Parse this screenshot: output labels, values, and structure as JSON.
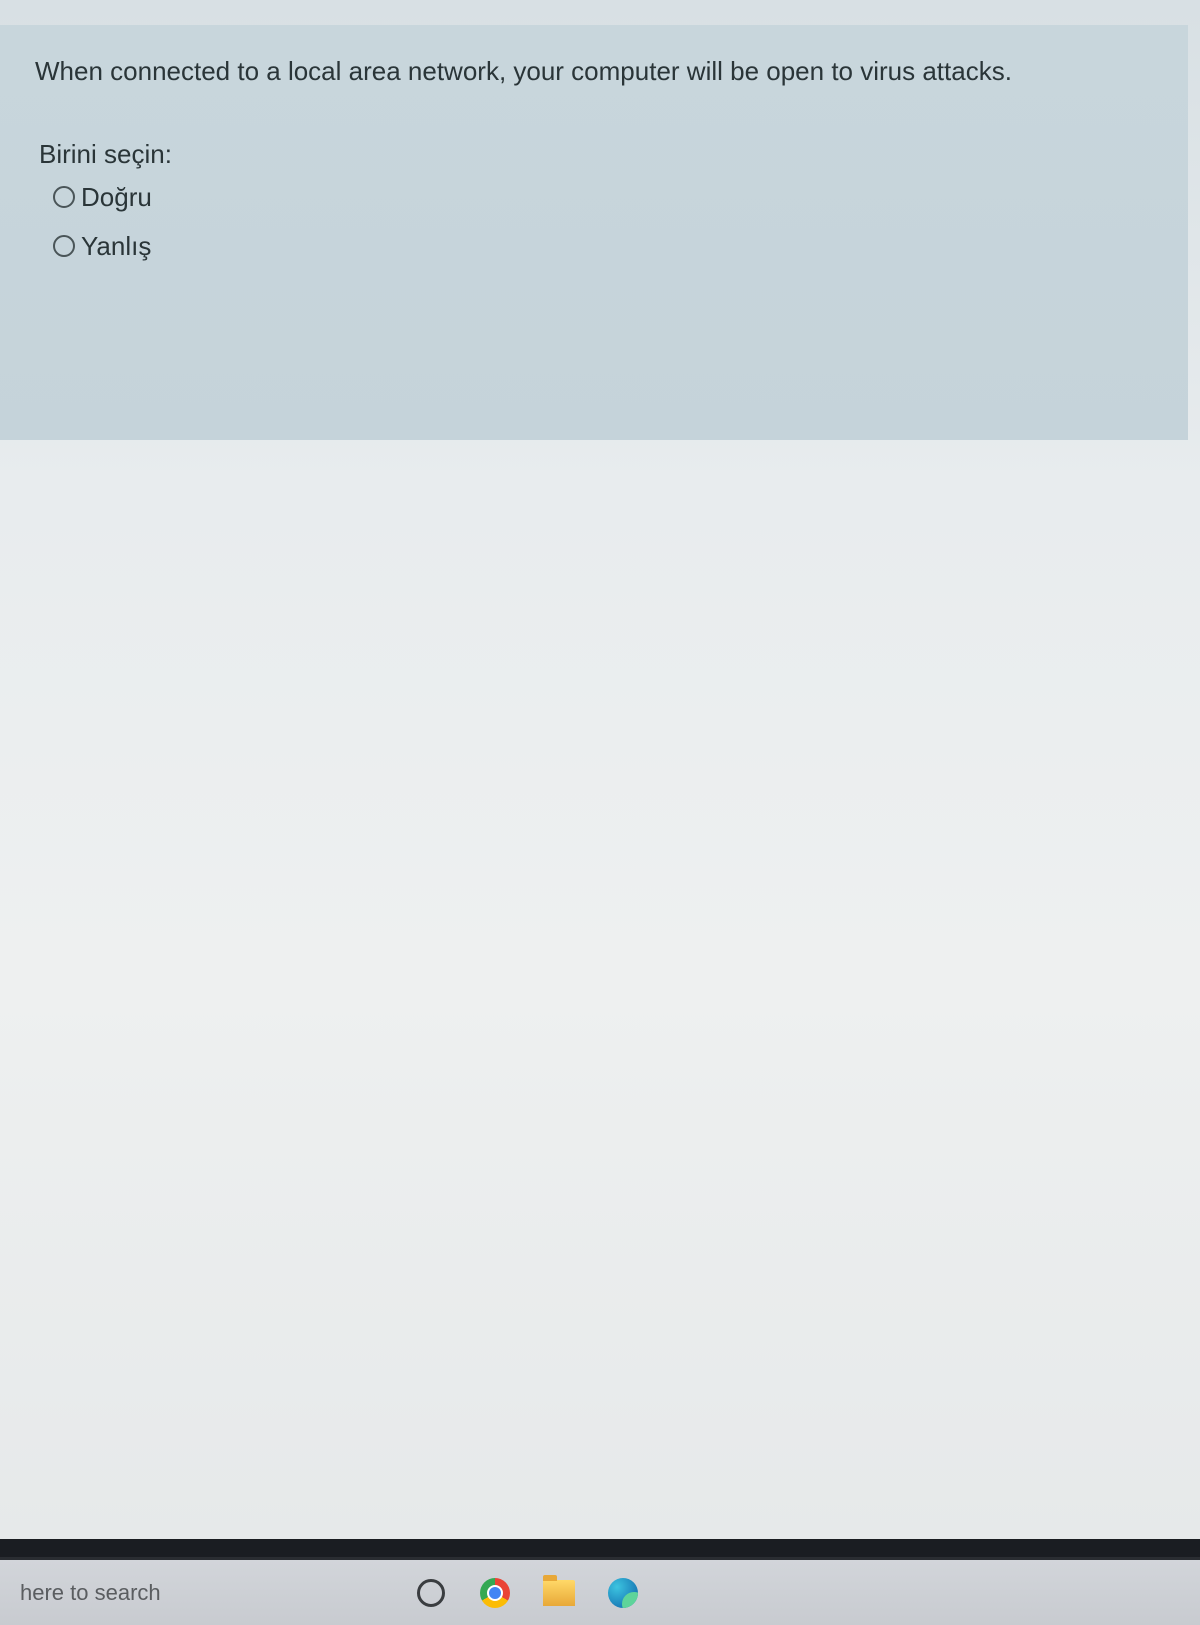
{
  "question": {
    "text": "When connected to a local area network, your computer will be open to virus attacks.",
    "select_prompt": "Birini seçin:",
    "options": [
      {
        "label": "Doğru"
      },
      {
        "label": "Yanlış"
      }
    ]
  },
  "taskbar": {
    "search_placeholder": "here to search"
  }
}
